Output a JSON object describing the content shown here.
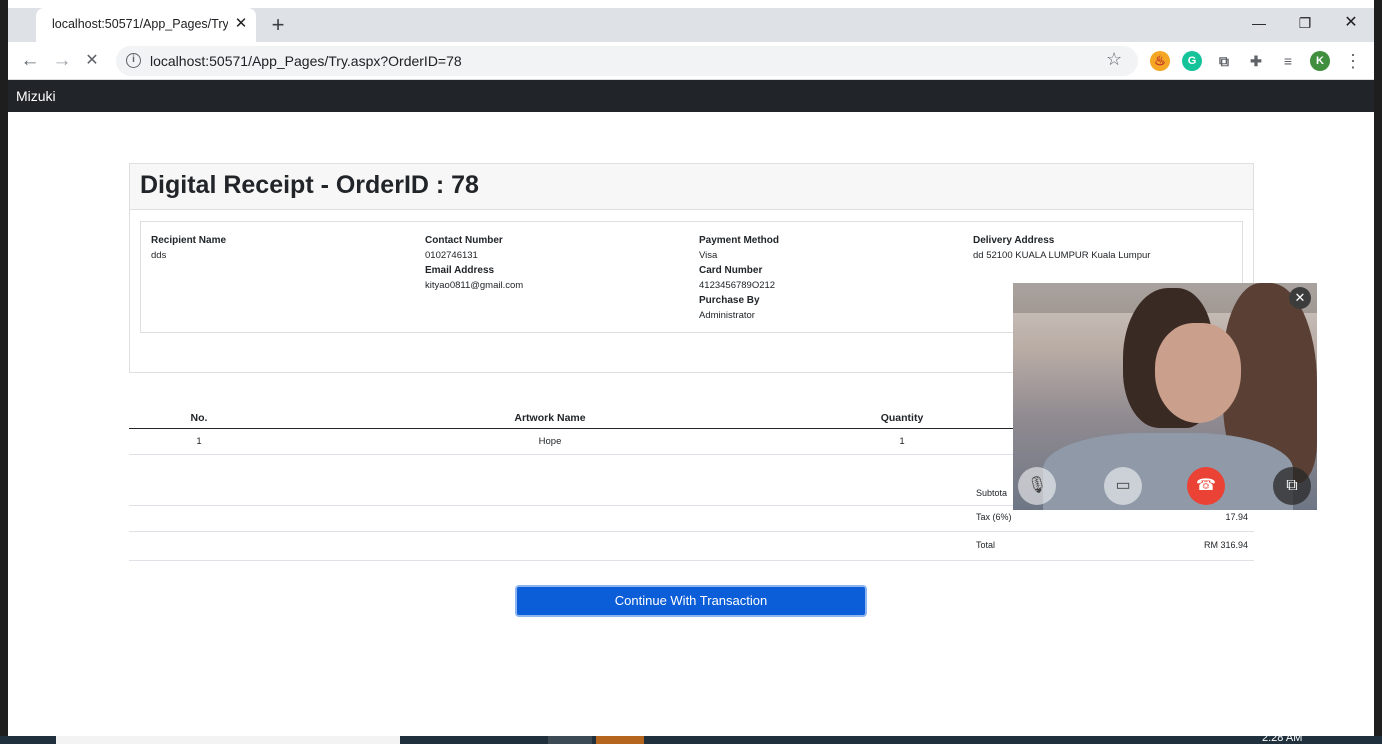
{
  "browser": {
    "tab_title": "localhost:50571/App_Pages/Try.a",
    "url": "localhost:50571/App_Pages/Try.aspx?OrderID=78",
    "profile_initial": "K"
  },
  "site": {
    "brand": "Mizuki"
  },
  "receipt": {
    "title": "Digital Receipt - OrderID : 78",
    "recipient_label": "Recipient Name",
    "recipient_value": "dds",
    "contact_label": "Contact Number",
    "contact_value": "0102746131",
    "email_label": "Email Address",
    "email_value": "kityao0811@gmail.com",
    "payment_label": "Payment Method",
    "payment_value": "Visa",
    "card_label": "Card Number",
    "card_value": "4123456789O212",
    "purchase_label": "Purchase By",
    "purchase_value": "Administrator",
    "delivery_label": "Delivery Address",
    "delivery_value": "dd 52100 KUALA LUMPUR Kuala Lumpur"
  },
  "items": {
    "headers": [
      "No.",
      "Artwork Name",
      "Quantity"
    ],
    "rows": [
      {
        "no": "1",
        "artwork": "Hope",
        "qty": "1"
      }
    ]
  },
  "totals": {
    "subtotal_label": "Subtota",
    "tax_label": "Tax (6%)",
    "tax_value": "17.94",
    "total_label": "Total",
    "total_value": "RM 316.94"
  },
  "actions": {
    "continue_label": "Continue With Transaction"
  },
  "taskbar": {
    "clock": "2:28 AM"
  },
  "colors": {
    "navbar": "#212529",
    "primary_button": "#0b5ed7",
    "hangup": "#ea4335"
  }
}
